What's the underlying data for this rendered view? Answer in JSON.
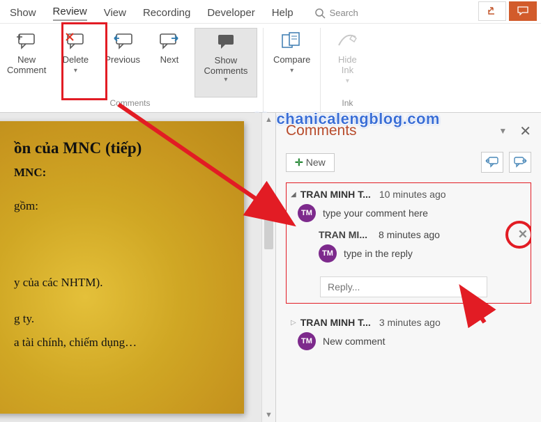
{
  "menu": {
    "items": [
      "Show",
      "Review",
      "View",
      "Recording",
      "Developer",
      "Help"
    ],
    "search": "Search",
    "active_index": 1
  },
  "ribbon": {
    "new_comment": "New\nComment",
    "delete": "Delete",
    "previous": "Previous",
    "next": "Next",
    "show_comments": "Show\nComments",
    "compare": "Compare",
    "hide_ink": "Hide\nInk",
    "group_comments": "Comments",
    "group_ink": "Ink"
  },
  "watermark": "Mechanicalengblog.com",
  "slide": {
    "title": "ồn của MNC (tiếp)",
    "sub": "MNC:",
    "line1": "gồm:",
    "line2": "y của các NHTM).",
    "line3": "g ty.",
    "line4": "a tài chính, chiếm dụng…"
  },
  "comments": {
    "title": "Comments",
    "new_label": "New",
    "threads": [
      {
        "author": "TRAN MINH T...",
        "time": "10 minutes ago",
        "avatar": "TM",
        "text": "type your comment here",
        "replies": [
          {
            "author": "TRAN MI...",
            "time": "8 minutes ago",
            "avatar": "TM",
            "text": "type in the reply"
          }
        ],
        "reply_placeholder": "Reply..."
      },
      {
        "author": "TRAN MINH T...",
        "time": "3 minutes ago",
        "avatar": "TM",
        "text": "New comment"
      }
    ]
  }
}
